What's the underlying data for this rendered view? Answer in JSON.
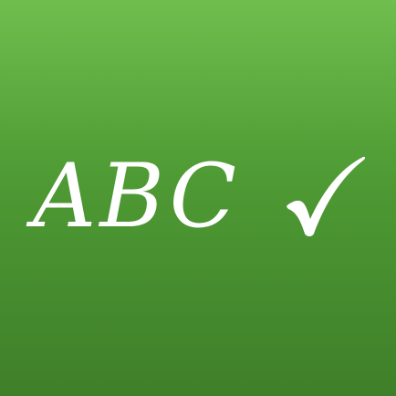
{
  "logo": {
    "text": "ABC",
    "check_glyph": "✓",
    "text_color": "#ffffff"
  },
  "background": {
    "top_color": "#6fbe4e",
    "bottom_color": "#3f7f29"
  },
  "icons": {
    "check": "check-mark-icon"
  }
}
